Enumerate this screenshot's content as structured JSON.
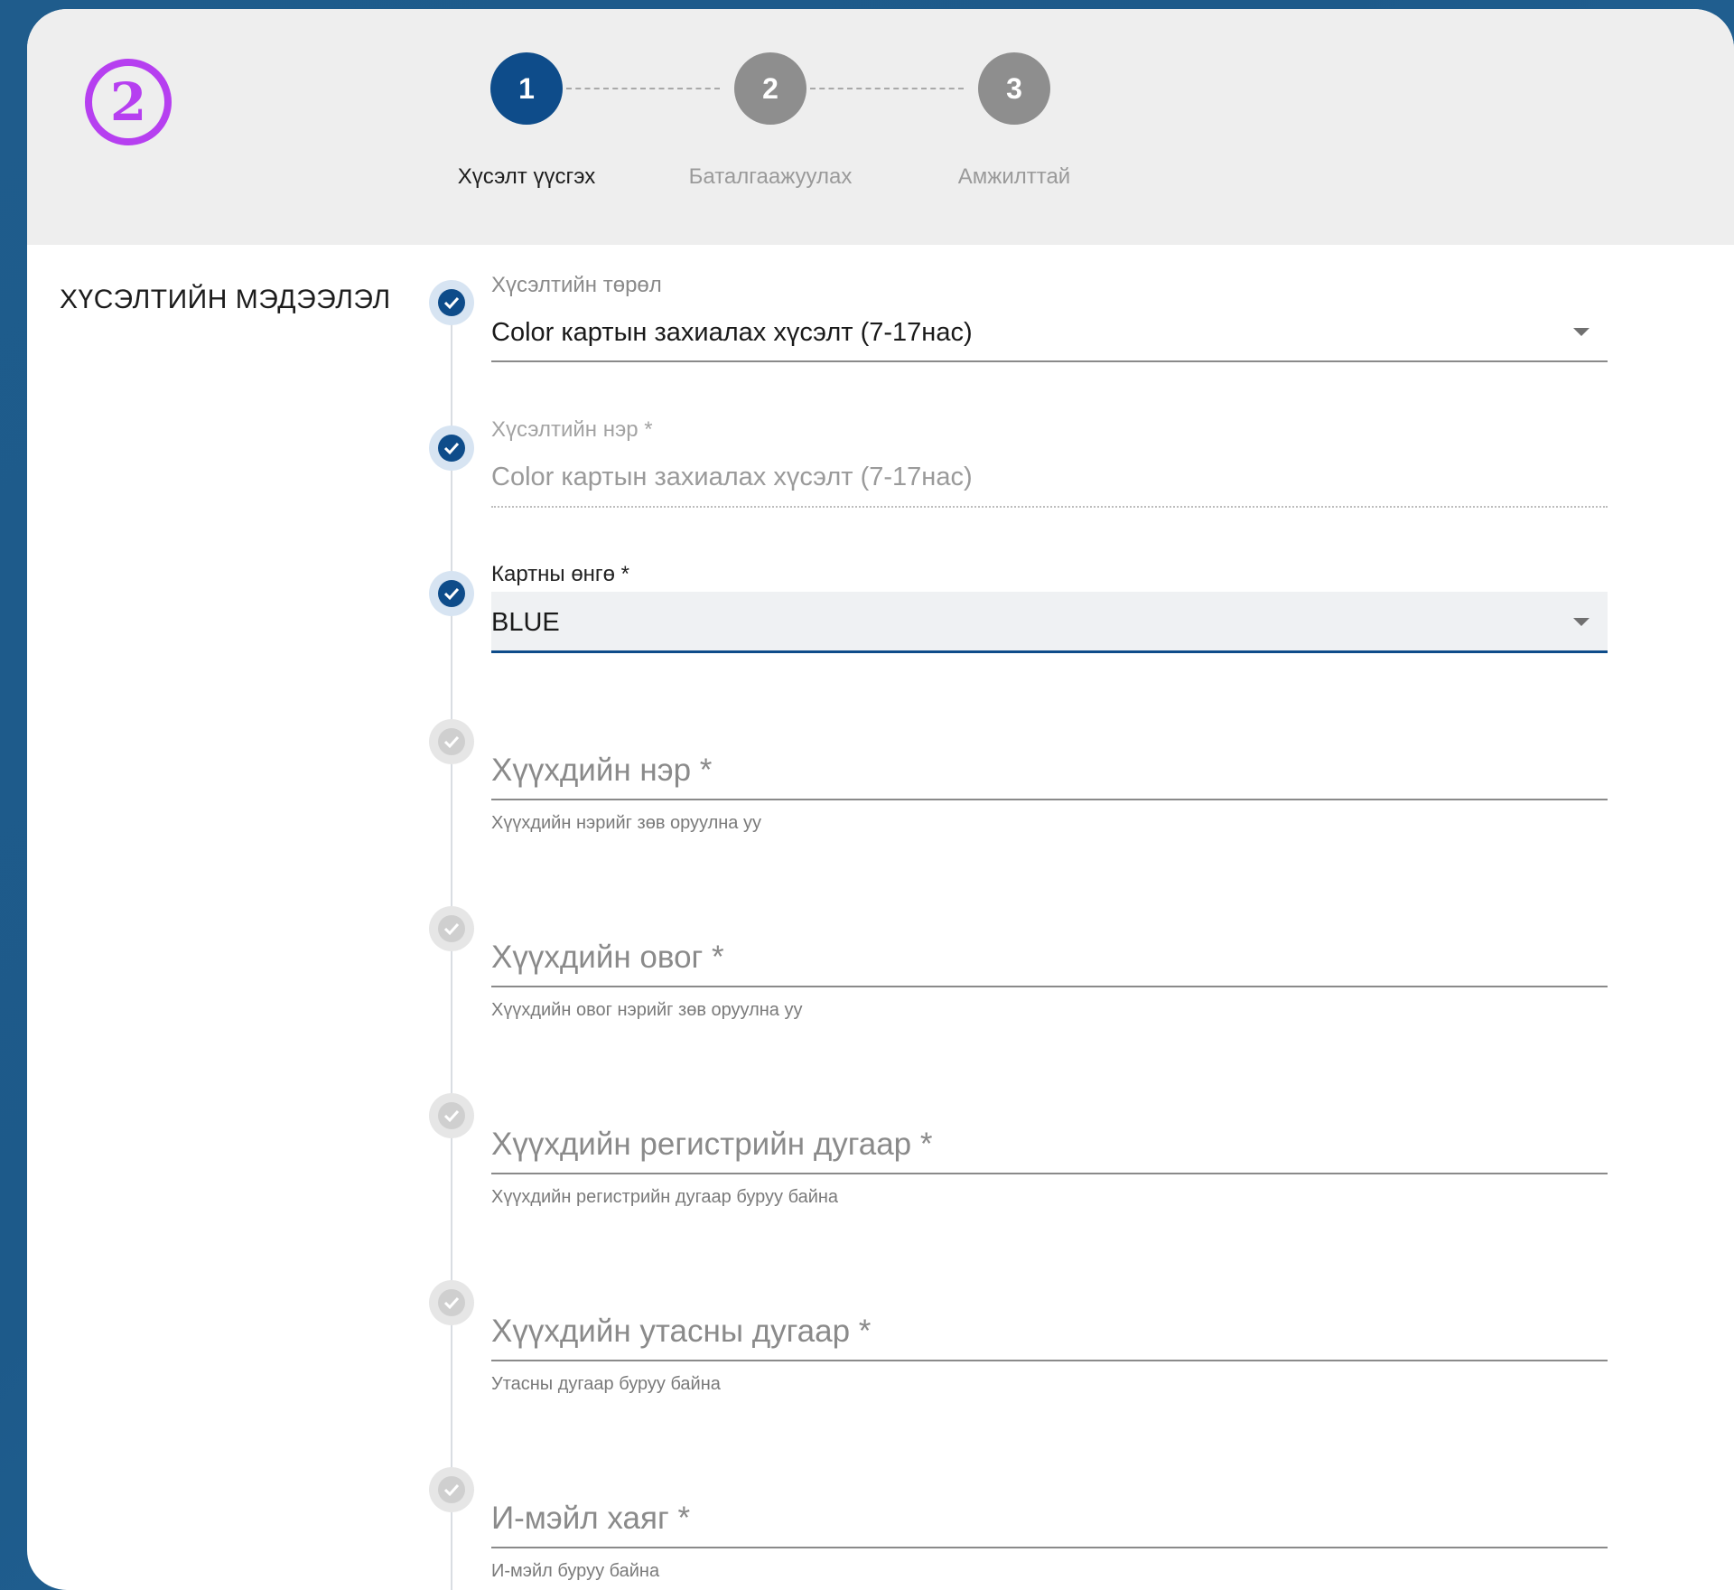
{
  "badge": "2",
  "stepper": {
    "steps": [
      {
        "number": "1",
        "label": "Хүсэлт үүсгэх"
      },
      {
        "number": "2",
        "label": "Баталгаажуулах"
      },
      {
        "number": "3",
        "label": "Амжилттай"
      }
    ],
    "active_step": 1
  },
  "section_title": "ХҮСЭЛТИЙН МЭДЭЭЛЭЛ",
  "fields": {
    "request_type": {
      "label": "Хүсэлтийн төрөл",
      "value": "Color картын захиалах хүсэлт (7-17нас)"
    },
    "request_name": {
      "label": "Хүсэлтийн нэр *",
      "value": "Color картын захиалах хүсэлт (7-17нас)"
    },
    "card_color": {
      "label": "Картны өнгө *",
      "value": "BLUE"
    },
    "child_name": {
      "placeholder": "Хүүхдийн нэр *",
      "hint": "Хүүхдийн нэрийг зөв оруулна уу"
    },
    "child_surname": {
      "placeholder": "Хүүхдийн овог *",
      "hint": "Хүүхдийн овог нэрийг зөв оруулна уу"
    },
    "child_register": {
      "placeholder": "Хүүхдийн регистрийн дугаар *",
      "hint": "Хүүхдийн регистрийн дугаар буруу байна"
    },
    "child_phone": {
      "placeholder": "Хүүхдийн утасны дугаар *",
      "hint": "Утасны дугаар буруу байна"
    },
    "email": {
      "placeholder": "И-мэйл хаяг *",
      "hint": "И-мэйл буруу байна"
    }
  },
  "colors": {
    "accent": "#0e4c8a",
    "badge": "#b63ff0",
    "background": "#1f5c8c"
  }
}
